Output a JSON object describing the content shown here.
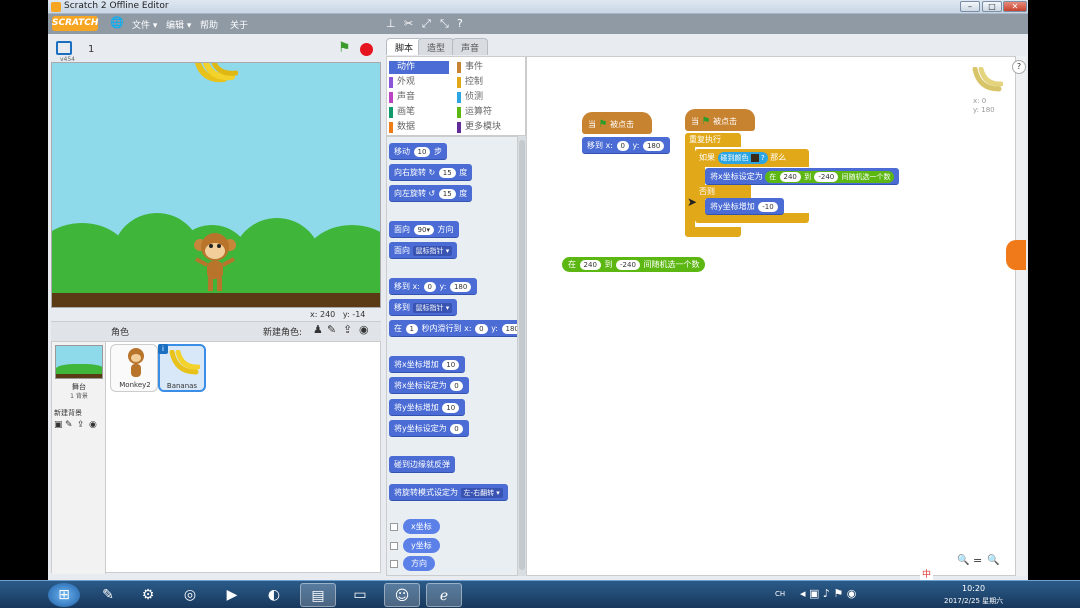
{
  "window": {
    "title": "Scratch 2 Offline Editor",
    "minimize": "–",
    "maximize": "□",
    "close": "✕"
  },
  "menu": {
    "logo": "SCRATCH",
    "file": "文件 ▾",
    "edit": "编辑 ▾",
    "help": "帮助",
    "about": "关于"
  },
  "stage": {
    "version": "v454",
    "number": "1",
    "coord_x_label": "x:",
    "coord_x": "240",
    "coord_y_label": "y:",
    "coord_y": "-14"
  },
  "sprites": {
    "header": "角色",
    "new_sprite": "新建角色:",
    "stage_label": "舞台",
    "stage_backdrops": "1 背景",
    "new_backdrop": "新建背景",
    "items": [
      {
        "name": "Monkey2"
      },
      {
        "name": "Bananas"
      }
    ]
  },
  "tabs": [
    {
      "label": "脚本"
    },
    {
      "label": "造型"
    },
    {
      "label": "声音"
    }
  ],
  "categories": [
    {
      "label": "动作",
      "color": "#4a6cd4"
    },
    {
      "label": "事件",
      "color": "#c88330"
    },
    {
      "label": "外观",
      "color": "#8a55d7"
    },
    {
      "label": "控制",
      "color": "#e1a91a"
    },
    {
      "label": "声音",
      "color": "#bb42c3"
    },
    {
      "label": "侦测",
      "color": "#2ca5e2"
    },
    {
      "label": "画笔",
      "color": "#0e9a6c"
    },
    {
      "label": "运算符",
      "color": "#5cb712"
    },
    {
      "label": "数据",
      "color": "#ee7d16"
    },
    {
      "label": "更多模块",
      "color": "#632d99"
    }
  ],
  "palette": {
    "move": "移动",
    "move_n": "10",
    "move_unit": "步",
    "turn_right": "向右旋转",
    "turn_right_n": "15",
    "deg": "度",
    "turn_left": "向左旋转",
    "turn_left_n": "15",
    "point_dir": "面向",
    "point_dir_n": "90▾",
    "point_dir_unit": "方向",
    "point_towards": "面向",
    "point_towards_dd": "鼠标指针 ▾",
    "goto_xy": "移到 x:",
    "goto_x": "0",
    "goto_y_label": "y:",
    "goto_y": "180",
    "goto": "移到",
    "goto_dd": "鼠标指针 ▾",
    "glide_pre": "在",
    "glide_n": "1",
    "glide_mid": "秒内滑行到 x:",
    "glide_x": "0",
    "glide_y_label": "y:",
    "glide_y": "180",
    "change_x": "将x坐标增加",
    "change_x_n": "10",
    "set_x": "将x坐标设定为",
    "set_x_n": "0",
    "change_y": "将y坐标增加",
    "change_y_n": "10",
    "set_y": "将y坐标设定为",
    "set_y_n": "0",
    "bounce": "碰到边缘就反弹",
    "rot_style": "将旋转模式设定为",
    "rot_style_dd": "左-右翻转 ▾",
    "rep_x": "x坐标",
    "rep_y": "y坐标",
    "rep_dir": "方向"
  },
  "scripts": {
    "hat1": "当",
    "hat1_end": "被点击",
    "s1_goto": "移到 x:",
    "s1_x": "0",
    "s1_y_label": "y:",
    "s1_y": "180",
    "hat2": "当",
    "hat2_end": "被点击",
    "forever": "重复执行",
    "if": "如果",
    "touching": "碰到颜色",
    "q": "?",
    "then": "那么",
    "set_x": "将x坐标设定为",
    "rand_pre": "在",
    "rand_a": "240",
    "rand_to": "到",
    "rand_b": "-240",
    "rand_end": "间随机选一个数",
    "else": "否则",
    "change_y": "将y坐标增加",
    "change_y_n": "-10",
    "loose_pre": "在",
    "loose_a": "240",
    "loose_to": "到",
    "loose_b": "-240",
    "loose_end": "间随机选一个数",
    "sprite_x_label": "x:",
    "sprite_x": "0",
    "sprite_y_label": "y:",
    "sprite_y": "180"
  },
  "zoom": {
    "out": "🔍",
    "reset": "=",
    "in": "🔍"
  },
  "taskbar": {
    "lang": "CH",
    "time": "10:20",
    "date": "2017/2/25 星期六",
    "ime": "中"
  }
}
